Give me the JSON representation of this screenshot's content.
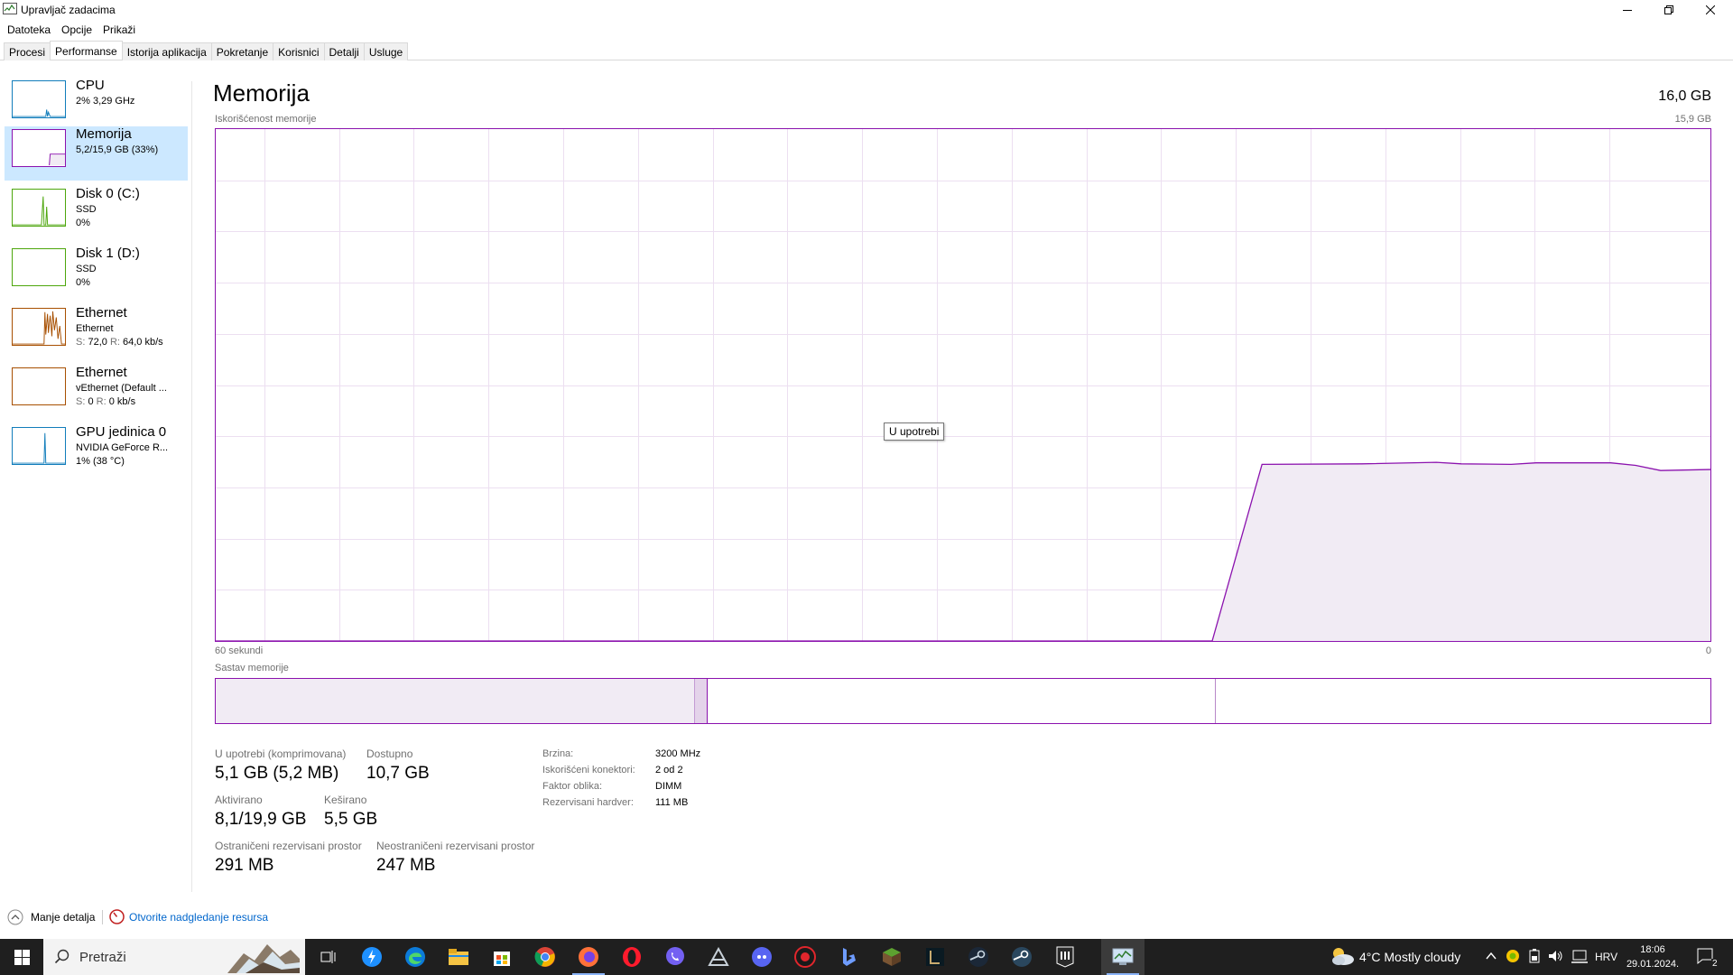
{
  "window": {
    "title": "Upravljač zadacima"
  },
  "menu": [
    "Datoteka",
    "Opcije",
    "Prikaži"
  ],
  "tabs": [
    "Procesi",
    "Performanse",
    "Istorija aplikacija",
    "Pokretanje",
    "Korisnici",
    "Detalji",
    "Usluge"
  ],
  "active_tab": "Performanse",
  "sidebar": {
    "items": [
      {
        "title": "CPU",
        "line1": "2% 3,29 GHz",
        "line2": "",
        "color": "#117dbb"
      },
      {
        "title": "Memorija",
        "line1": "5,2/15,9 GB (33%)",
        "line2": "",
        "color": "#8b12ae",
        "selected": true
      },
      {
        "title": "Disk 0 (C:)",
        "line1": "SSD",
        "line2": "0%",
        "color": "#4da60c"
      },
      {
        "title": "Disk 1 (D:)",
        "line1": "SSD",
        "line2": "0%",
        "color": "#4da60c"
      },
      {
        "title": "Ethernet",
        "line1": "Ethernet",
        "line2_s_label": "S:",
        "line2_s": "72,0",
        "line2_r_label": "R:",
        "line2_r": "64,0 kb/s",
        "color": "#a74f01"
      },
      {
        "title": "Ethernet",
        "line1": "vEthernet (Default ...",
        "line2_s_label": "S:",
        "line2_s": "0",
        "line2_r_label": "R:",
        "line2_r": "0 kb/s",
        "color": "#a74f01"
      },
      {
        "title": "GPU jedinica 0",
        "line1": "NVIDIA GeForce R...",
        "line2": "1% (38 °C)",
        "color": "#117dbb"
      }
    ]
  },
  "main": {
    "title": "Memorija",
    "total": "16,0 GB",
    "usage_label": "Iskorišćenost memorije",
    "usage_max": "15,9 GB",
    "time_left": "60 sekundi",
    "time_right": "0",
    "composition_label": "Sastav memorije",
    "tooltip": "U upotrebi",
    "graph_color": "#8b12ae",
    "graph_fill": "#f1ebf4"
  },
  "chart_data": {
    "type": "area",
    "x_unit": "seconds ago",
    "x": [
      60,
      20,
      18,
      14,
      11,
      10,
      8,
      7,
      5,
      4,
      3,
      2,
      0
    ],
    "y_percent": [
      0,
      0,
      34.5,
      34.6,
      34.9,
      34.6,
      34.5,
      34.8,
      34.8,
      34.8,
      34.3,
      33.3,
      33.5
    ],
    "ylim": [
      0,
      100
    ],
    "grid": true
  },
  "composition": {
    "in_use_fraction": 0.32,
    "modified_fraction": 0.009,
    "standby_fraction": 0.34,
    "free_fraction": 0.331
  },
  "stats": {
    "in_use_label": "U upotrebi (komprimovana)",
    "in_use_value": "5,1 GB (5,2 MB)",
    "available_label": "Dostupno",
    "available_value": "10,7 GB",
    "committed_label": "Aktivirano",
    "committed_value": "8,1/19,9 GB",
    "cached_label": "Keširano",
    "cached_value": "5,5 GB",
    "paged_label": "Ostraničeni rezervisani prostor",
    "paged_value": "291 MB",
    "nonpaged_label": "Neostraničeni rezervisani prostor",
    "nonpaged_value": "247 MB"
  },
  "details": [
    {
      "key": "Brzina:",
      "value": "3200 MHz"
    },
    {
      "key": "Iskorišćeni konektori:",
      "value": "2 od 2"
    },
    {
      "key": "Faktor oblika:",
      "value": "DIMM"
    },
    {
      "key": "Rezervisani hardver:",
      "value": "111 MB"
    }
  ],
  "footer": {
    "fewer_details": "Manje detalja",
    "resource_monitor": "Otvorite nadgledanje resursa"
  },
  "taskbar": {
    "search_placeholder": "Pretraži",
    "weather": "4°C  Mostly cloudy",
    "language": "HRV",
    "time": "18:06",
    "date": "29.01.2024.",
    "notifications": "2",
    "apps": [
      "task-view",
      "messenger",
      "edge",
      "file-explorer",
      "store",
      "chrome",
      "firefox",
      "opera",
      "viber",
      "affinity",
      "discord",
      "app-red",
      "bing",
      "minecraft",
      "app-lib",
      "steam",
      "steam2",
      "epic-games",
      "task-manager"
    ]
  }
}
